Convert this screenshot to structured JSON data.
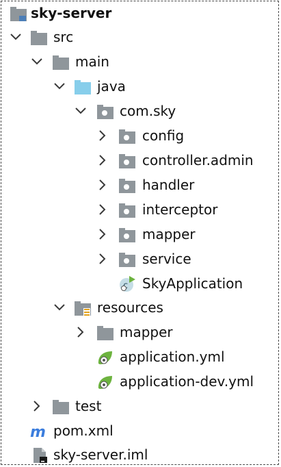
{
  "project_tree": {
    "root": {
      "label": "sky-server",
      "icon": "module-folder-icon"
    },
    "src": {
      "label": "src",
      "icon": "folder-icon"
    },
    "main": {
      "label": "main",
      "icon": "folder-icon"
    },
    "java": {
      "label": "java",
      "icon": "source-root-folder-icon"
    },
    "package": {
      "label": "com.sky",
      "icon": "package-icon"
    },
    "subpackages": [
      {
        "label": "config",
        "icon": "package-icon"
      },
      {
        "label": "controller.admin",
        "icon": "package-icon"
      },
      {
        "label": "handler",
        "icon": "package-icon"
      },
      {
        "label": "interceptor",
        "icon": "package-icon"
      },
      {
        "label": "mapper",
        "icon": "package-icon"
      },
      {
        "label": "service",
        "icon": "package-icon"
      }
    ],
    "app_class": {
      "label": "SkyApplication",
      "icon": "spring-boot-class-icon"
    },
    "resources": {
      "label": "resources",
      "icon": "resources-root-folder-icon"
    },
    "resources_mapper": {
      "label": "mapper",
      "icon": "folder-icon"
    },
    "yml_files": [
      {
        "label": "application.yml",
        "icon": "spring-config-icon"
      },
      {
        "label": "application-dev.yml",
        "icon": "spring-config-icon"
      }
    ],
    "test": {
      "label": "test",
      "icon": "folder-icon"
    },
    "pom": {
      "label": "pom.xml",
      "icon": "maven-icon"
    },
    "iml": {
      "label": "sky-server.iml",
      "icon": "iml-file-icon"
    }
  },
  "colors": {
    "folder": "#8f969b",
    "source_root": "#87ceeb",
    "chevron": "#3a3a3a",
    "spring_green": "#6db33f",
    "maven_blue": "#3b7ddd",
    "resource_bars": "#e3a21a"
  }
}
